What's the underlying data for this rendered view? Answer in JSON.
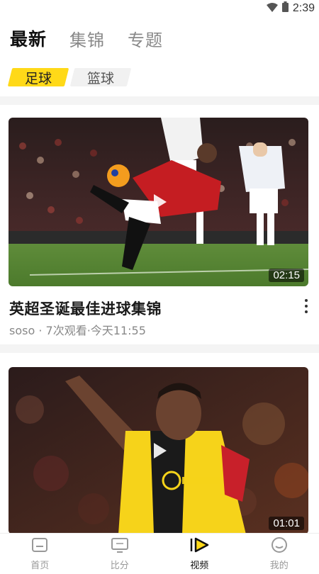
{
  "status_bar": {
    "time": "2:39",
    "icons": [
      "wifi-icon",
      "battery-icon"
    ]
  },
  "top_tabs": [
    {
      "label": "最新",
      "active": true
    },
    {
      "label": "集锦",
      "active": false
    },
    {
      "label": "专题",
      "active": false
    }
  ],
  "sub_tabs": [
    {
      "label": "足球",
      "active": true
    },
    {
      "label": "篮球",
      "active": false
    }
  ],
  "videos": [
    {
      "title": "英超圣诞最佳进球集锦",
      "meta": "soso · 7次观看·今天11:55",
      "duration": "02:15"
    },
    {
      "title": "",
      "meta": "",
      "duration": "01:01"
    }
  ],
  "bottom_nav": [
    {
      "label": "首页",
      "icon": "home-icon",
      "active": false
    },
    {
      "label": "比分",
      "icon": "score-icon",
      "active": false
    },
    {
      "label": "视频",
      "icon": "video-icon",
      "active": true
    },
    {
      "label": "我的",
      "icon": "profile-icon",
      "active": false
    }
  ],
  "colors": {
    "accent": "#ffd918",
    "text": "#111111",
    "muted": "#999999"
  }
}
